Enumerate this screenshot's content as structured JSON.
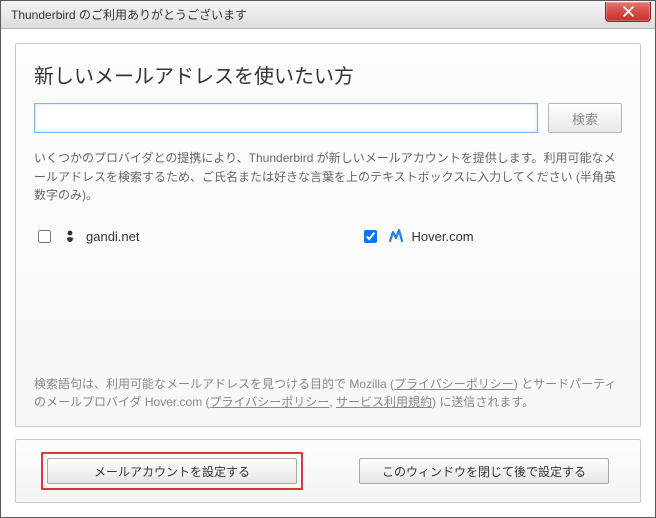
{
  "window": {
    "title": "Thunderbird のご利用ありがとうございます"
  },
  "panel": {
    "heading": "新しいメールアドレスを使いたい方",
    "search_value": "",
    "search_placeholder": "",
    "search_button": "検索",
    "description": "いくつかのプロバイダとの提携により、Thunderbird が新しいメールアカウントを提供します。利用可能なメールアドレスを検索するため、ご氏名または好きな言葉を上のテキストボックスに入力してください (半角英数字のみ)。"
  },
  "providers": [
    {
      "id": "gandi",
      "label": "gandi.net",
      "checked": false,
      "icon": "gandi-icon"
    },
    {
      "id": "hover",
      "label": "Hover.com",
      "checked": true,
      "icon": "hover-icon"
    }
  ],
  "footnote": {
    "prefix": "検索語句は、利用可能なメールアドレスを見つける目的で Mozilla (",
    "link1": "プライバシーポリシー",
    "mid1": ") とサードパーティのメールプロバイダ Hover.com (",
    "link2": "プライバシーポリシー",
    "mid2": ", ",
    "link3": "サービス利用規約",
    "suffix": ") に送信されます。"
  },
  "buttons": {
    "configure": "メールアカウントを設定する",
    "later": "このウィンドウを閉じて後で設定する"
  },
  "colors": {
    "close_red": "#c9302c",
    "highlight_red": "#d93a2f",
    "focus_blue": "#7eb4ea"
  }
}
